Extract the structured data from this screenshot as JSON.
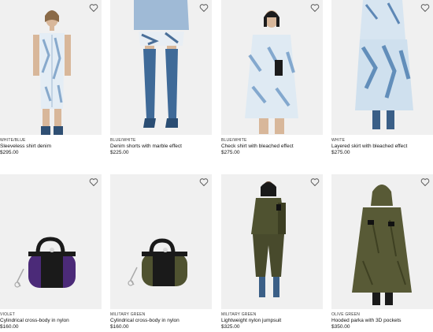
{
  "products": [
    {
      "color": "WHITE/BLUE",
      "name": "Sleeveless shirt denim",
      "price": "$295.00"
    },
    {
      "color": "BLUE/WHITE",
      "name": "Denim shorts with marble effect",
      "price": "$225.00"
    },
    {
      "color": "BLUE/WHITE",
      "name": "Check shirt with bleached effect",
      "price": "$275.00"
    },
    {
      "color": "WHITE",
      "name": "Layered skirt with bleached effect",
      "price": "$275.00"
    },
    {
      "color": "VIOLET",
      "name": "Cylindrical cross-body in nylon",
      "price": "$160.00"
    },
    {
      "color": "MILITARY GREEN",
      "name": "Cylindrical cross-body in nylon",
      "price": "$160.00"
    },
    {
      "color": "MILITARY GREEN",
      "name": "Lightweight nylon jumpsuit",
      "price": "$325.00"
    },
    {
      "color": "OLIVE GREEN",
      "name": "Hooded parka with 3D pockets",
      "price": "$350.00"
    }
  ],
  "colors": {
    "card_bg": "#f0f0f0",
    "denim_light": "#c9dbea",
    "denim_blue": "#5d87b5",
    "denim_dark": "#2f4f73",
    "violet": "#4b2a78",
    "military": "#4f5230",
    "olive": "#585a36",
    "black": "#161616"
  },
  "icons": {
    "wishlist": "heart-outline-icon"
  }
}
